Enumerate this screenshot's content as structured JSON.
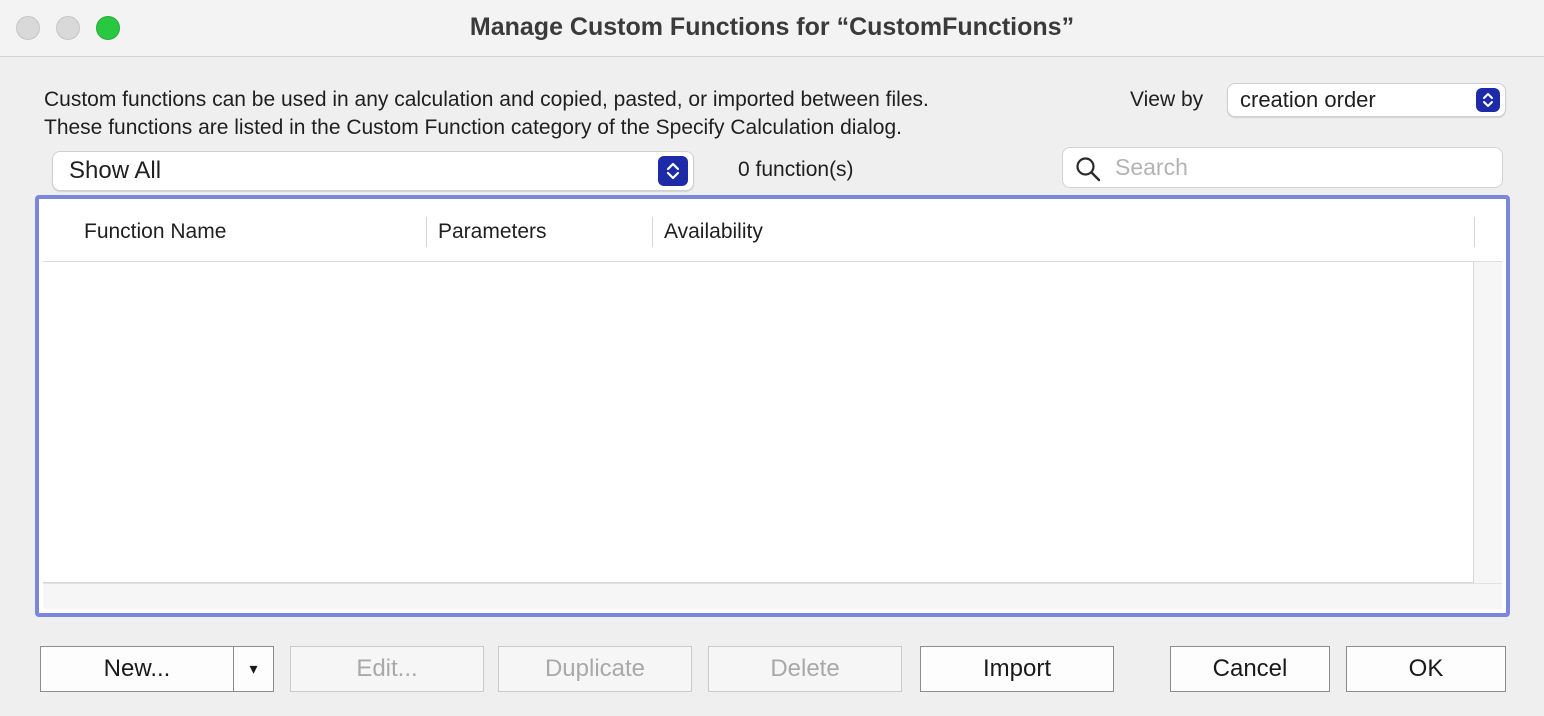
{
  "window": {
    "title": "Manage Custom Functions for “CustomFunctions”"
  },
  "description": {
    "line1": "Custom functions can be used in any calculation and copied, pasted, or imported between files.",
    "line2": "These functions are listed in the Custom Function category of the Specify Calculation dialog."
  },
  "view_by": {
    "label": "View by",
    "selected": "creation order"
  },
  "filter": {
    "selected": "Show All"
  },
  "function_count": "0 function(s)",
  "search": {
    "placeholder": "Search",
    "value": ""
  },
  "table": {
    "columns": [
      "Function Name",
      "Parameters",
      "Availability"
    ],
    "rows": []
  },
  "buttons": {
    "new": "New...",
    "new_menu": "▾",
    "edit": "Edit...",
    "duplicate": "Duplicate",
    "delete": "Delete",
    "import": "Import",
    "cancel": "Cancel",
    "ok": "OK"
  },
  "colors": {
    "accent": "#1e2ba8",
    "focus_ring": "#7a87dc",
    "zoom_button": "#2ac840"
  },
  "icons": {
    "search": "magnifying-glass",
    "popup": "up-down-chevrons",
    "menu": "triangle-down"
  }
}
